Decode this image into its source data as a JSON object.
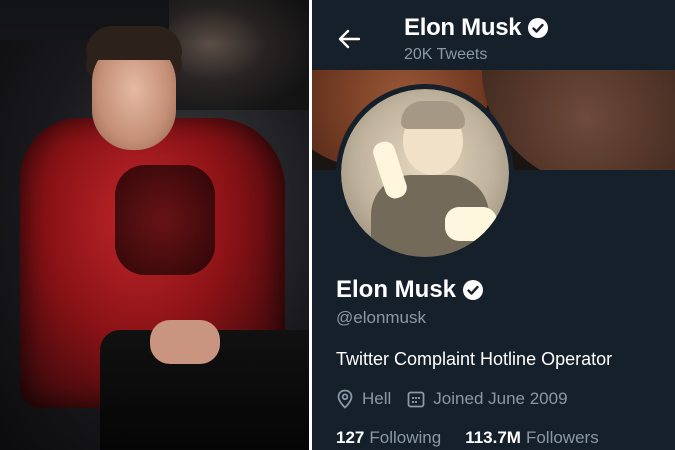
{
  "header": {
    "name": "Elon Musk",
    "tweet_count": "20K Tweets"
  },
  "profile": {
    "name": "Elon Musk",
    "handle": "@elonmusk",
    "bio": "Twitter Complaint Hotline Operator",
    "location": "Hell",
    "joined": "Joined June 2009",
    "following_count": "127",
    "following_label": "Following",
    "followers_count": "113.7M",
    "followers_label": "Followers"
  },
  "icons": {
    "back": "arrow-left-icon",
    "verified": "verified-badge-icon",
    "location": "location-pin-icon",
    "calendar": "calendar-icon"
  },
  "colors": {
    "background": "#15202b",
    "primary_text": "#ffffff",
    "secondary_text": "#8b98a5"
  }
}
